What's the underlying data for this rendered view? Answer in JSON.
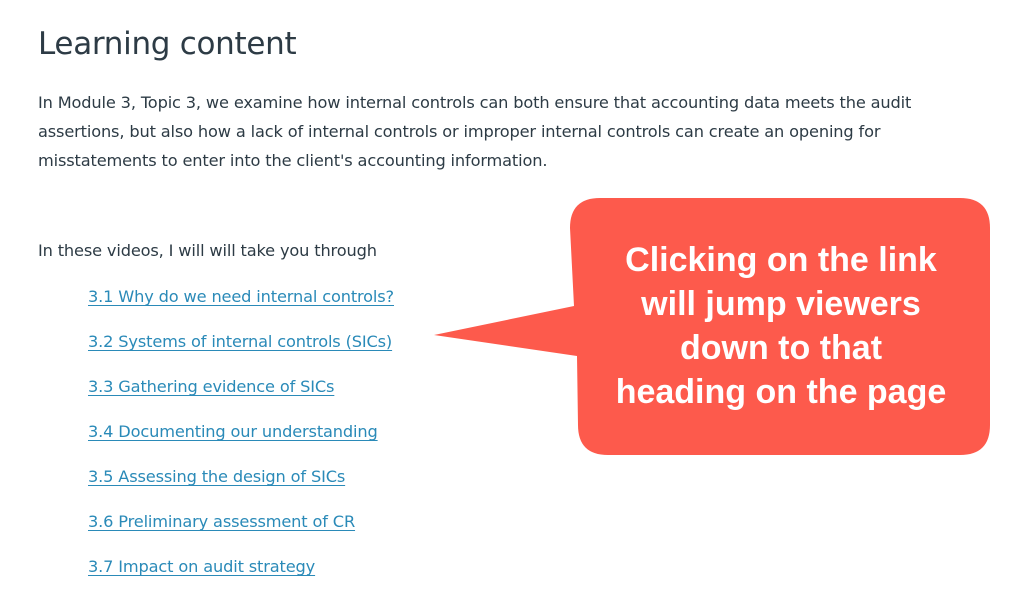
{
  "page": {
    "title": "Learning content",
    "intro": "In Module 3, Topic 3, we examine how internal controls can both ensure that accounting data meets the audit assertions, but also how a lack of internal controls or improper internal controls can create an opening for misstatements to enter into the client's accounting information.",
    "lead": "In these videos, I will will take you through"
  },
  "toc": {
    "links": [
      {
        "label": "3.1 Why do we need internal controls?"
      },
      {
        "label": "3.2 Systems of internal controls (SICs)"
      },
      {
        "label": "3.3 Gathering evidence of SICs"
      },
      {
        "label": "3.4 Documenting our understanding"
      },
      {
        "label": "3.5 Assessing the design of SICs"
      },
      {
        "label": "3.6 Preliminary assessment of CR"
      },
      {
        "label": "3.7 Impact on audit strategy"
      }
    ]
  },
  "callout": {
    "lines": [
      "Clicking on the link",
      "will jump viewers",
      "down to that",
      "heading on the page"
    ],
    "color": "#fd5a4c",
    "text_color": "#ffffff",
    "points_to": "3.2 Systems of internal controls (SICs)"
  },
  "colors": {
    "text": "#2d3b45",
    "link": "#2a8ab8",
    "background": "#ffffff"
  }
}
